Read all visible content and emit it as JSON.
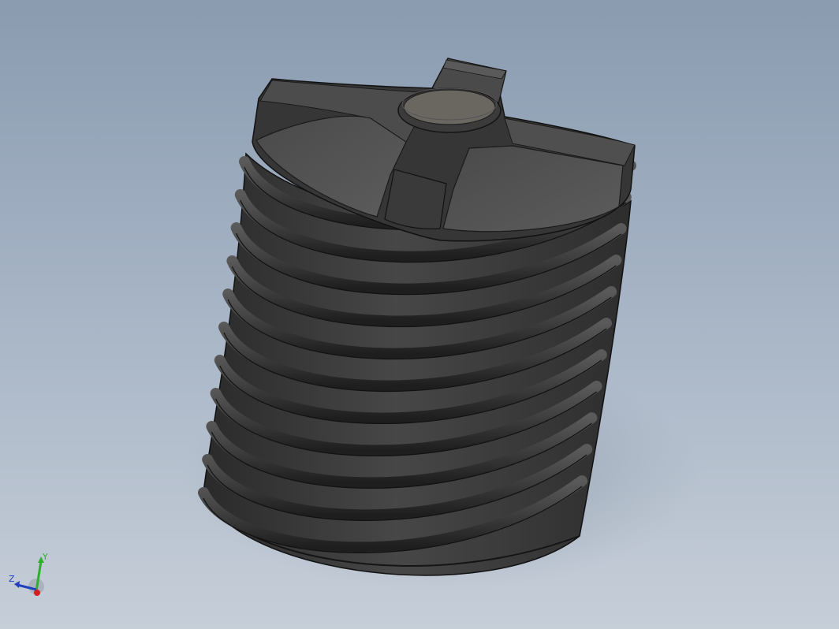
{
  "viewport": {
    "background_top": "#8a9bb0",
    "background_bottom": "#c6ced8"
  },
  "model": {
    "color": "#3c3c3c",
    "rib_count": 11
  },
  "triad": {
    "x_axis_color": "#d02020",
    "y_axis_color": "#2fae2f",
    "z_axis_color": "#2040c0",
    "y_label": "Y",
    "z_label": "Z"
  }
}
